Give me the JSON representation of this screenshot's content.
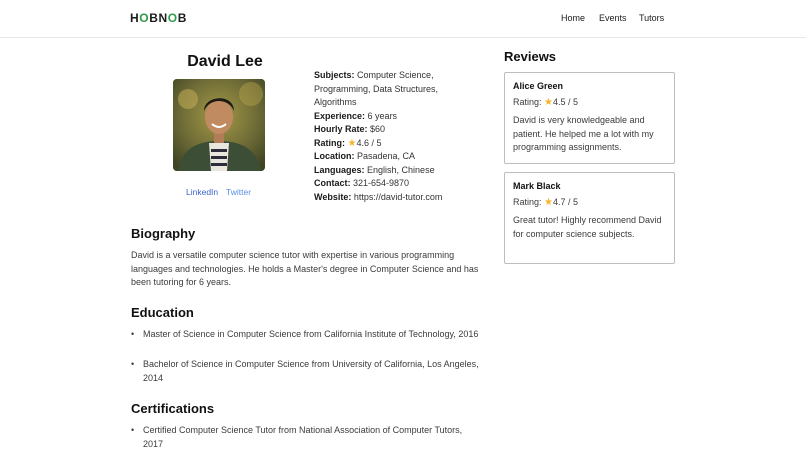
{
  "header": {
    "logo": "HOBNOB",
    "nav": [
      "Home",
      "Events",
      "Tutors"
    ]
  },
  "tutor": {
    "name": "David Lee",
    "social": [
      "LinkedIn",
      "Twitter"
    ],
    "details": {
      "subjects_label": "Subjects:",
      "subjects_value": "Computer Science, Programming, Data Structures, Algorithms",
      "experience_label": "Experience:",
      "experience_value": "6 years",
      "hourly_label": "Hourly Rate:",
      "hourly_value": "$60",
      "rating_label": "Rating:",
      "rating_value": "4.6 / 5",
      "location_label": "Location:",
      "location_value": "Pasadena, CA",
      "languages_label": "Languages:",
      "languages_value": "English, Chinese",
      "contact_label": "Contact:",
      "contact_value": "321-654-9870",
      "website_label": "Website:",
      "website_value": "https://david-tutor.com"
    }
  },
  "biography": {
    "title": "Biography",
    "text": "David is a versatile computer science tutor with expertise in various programming languages and technologies. He holds a Master's degree in Computer Science and has been tutoring for 6 years."
  },
  "education": {
    "title": "Education",
    "items": [
      "Master of Science in Computer Science from California Institute of Technology, 2016",
      "Bachelor of Science in Computer Science from University of California, Los Angeles, 2014"
    ]
  },
  "certifications": {
    "title": "Certifications",
    "items": [
      "Certified Computer Science Tutor from National Association of Computer Tutors, 2017"
    ]
  },
  "reviews": {
    "title": "Reviews",
    "rating_label": "Rating:",
    "items": [
      {
        "name": "Alice Green",
        "rating": "4.5 / 5",
        "text": "David is very knowledgeable and patient. He helped me a lot with my programming assignments."
      },
      {
        "name": "Mark Black",
        "rating": "4.7 / 5",
        "text": "Great tutor! Highly recommend David for computer science subjects."
      }
    ]
  },
  "colors": {
    "accent": "#2e9b48",
    "star": "#f3b62a",
    "link": "#3b63c8"
  }
}
